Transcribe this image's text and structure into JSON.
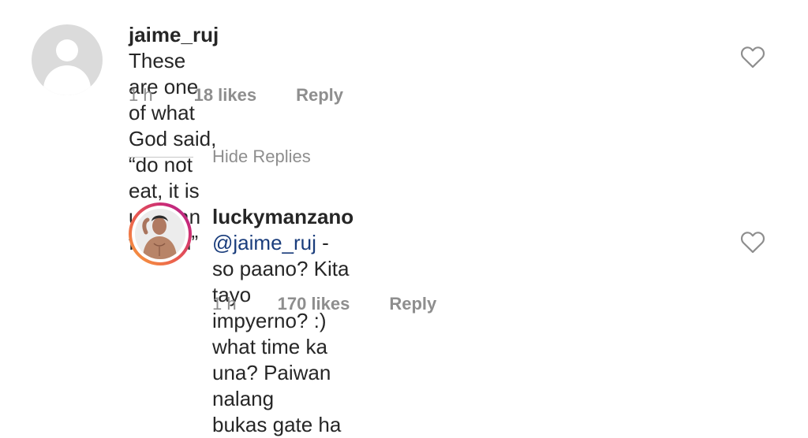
{
  "comments": [
    {
      "username": "jaime_ruj",
      "text_line1": " These are one of what God said, “do not eat, it is",
      "text_line2": "unclean for you”",
      "time": "1 h",
      "likes": "18 likes",
      "reply_label": "Reply",
      "avatar_icon": "default-profile-icon"
    }
  ],
  "hide_replies_label": "Hide Replies",
  "replies": [
    {
      "username": "luckymanzano",
      "mention": "@jaime_ruj",
      "text_line1": " - so paano? Kita tayo",
      "text_line2": "impyerno? :) what time ka una? Paiwan nalang",
      "text_line3": "bukas gate ha",
      "time": "1 h",
      "likes": "170 likes",
      "reply_label": "Reply",
      "avatar_icon": "profile-photo-avatar"
    }
  ],
  "colors": {
    "text": "#262626",
    "meta": "#8e8e8e",
    "mention": "#1a3d7c",
    "story_ring_start": "#f9a43a",
    "story_ring_end": "#a23a9c"
  },
  "icons": {
    "like": "heart-outline-icon"
  }
}
